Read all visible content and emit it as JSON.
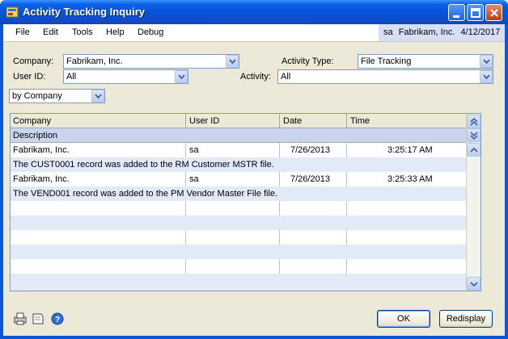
{
  "window": {
    "title": "Activity Tracking Inquiry"
  },
  "menu": [
    "File",
    "Edit",
    "Tools",
    "Help",
    "Debug"
  ],
  "userinfo": {
    "user": "sa",
    "company": "Fabrikam, Inc.",
    "date": "4/12/2017"
  },
  "filters": {
    "company_label": "Company:",
    "company_value": "Fabrikam, Inc.",
    "activity_type_label": "Activity Type:",
    "activity_type_value": "File Tracking",
    "userid_label": "User ID:",
    "userid_value": "All",
    "activity_label": "Activity:",
    "activity_value": "All",
    "sort_value": "by Company"
  },
  "grid": {
    "headers": {
      "company": "Company",
      "userid": "User ID",
      "date": "Date",
      "time": "Time",
      "description": "Description"
    },
    "records": [
      {
        "company": "Fabrikam, Inc.",
        "userid": "sa",
        "date": "7/26/2013",
        "time": "3:25:17 AM",
        "description": "The CUST0001 record was added to the RM Customer MSTR file."
      },
      {
        "company": "Fabrikam, Inc.",
        "userid": "sa",
        "date": "7/26/2013",
        "time": "3:25:33 AM",
        "description": "The VEND001 record was added to the PM Vendor Master File file."
      }
    ]
  },
  "buttons": {
    "ok": "OK",
    "redisplay": "Redisplay"
  },
  "icons": [
    "printer-icon",
    "note-icon",
    "help-icon"
  ]
}
